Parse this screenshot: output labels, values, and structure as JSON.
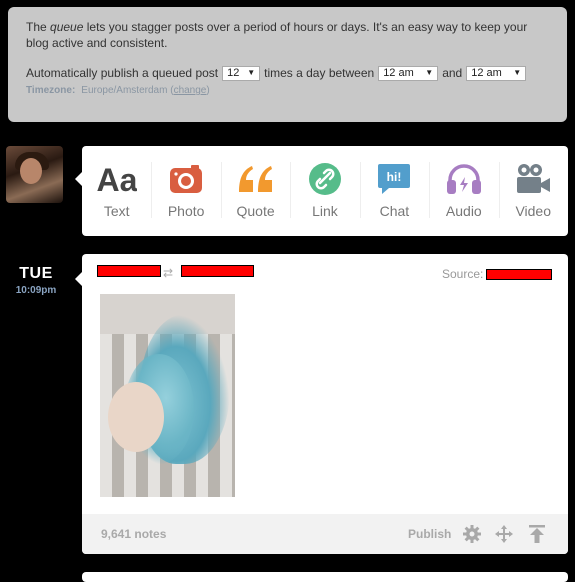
{
  "queue_info": {
    "desc_pre": "The ",
    "desc_em": "queue",
    "desc_post": " lets you stagger posts over a period of hours or days. It's an easy way to keep your blog active and consistent.",
    "auto_publish_label": "Automatically publish a queued post",
    "times_value": "12",
    "times_label": "times a day between",
    "start_value": "12 am",
    "and_label": "and",
    "end_value": "12 am",
    "timezone_label": "Timezone:",
    "timezone_value": "Europe/Amsterdam",
    "change_open": "(",
    "change_link": "change",
    "change_close": ")"
  },
  "post_types": [
    {
      "name": "text",
      "label": "Text",
      "icon": "text-icon",
      "color": "#444444"
    },
    {
      "name": "photo",
      "label": "Photo",
      "icon": "camera-icon",
      "color": "#d95e40"
    },
    {
      "name": "quote",
      "label": "Quote",
      "icon": "quote-icon",
      "color": "#f2992e"
    },
    {
      "name": "link",
      "label": "Link",
      "icon": "link-icon",
      "color": "#56bc8a"
    },
    {
      "name": "chat",
      "label": "Chat",
      "icon": "chat-icon",
      "color": "#529ecc",
      "icon_text": "hi!"
    },
    {
      "name": "audio",
      "label": "Audio",
      "icon": "headphones-icon",
      "color": "#a77dc2"
    },
    {
      "name": "video",
      "label": "Video",
      "icon": "video-camera-icon",
      "color": "#748089"
    }
  ],
  "queued_post": {
    "day": "TUE",
    "time": "10:09pm",
    "source_label": "Source:",
    "notes": "9,641 notes",
    "publish_label": "Publish"
  },
  "colors": {
    "background": "#000000",
    "info_box": "#c8c8c8",
    "redaction": "#ff0000",
    "time_blue": "#8aa4c2"
  }
}
